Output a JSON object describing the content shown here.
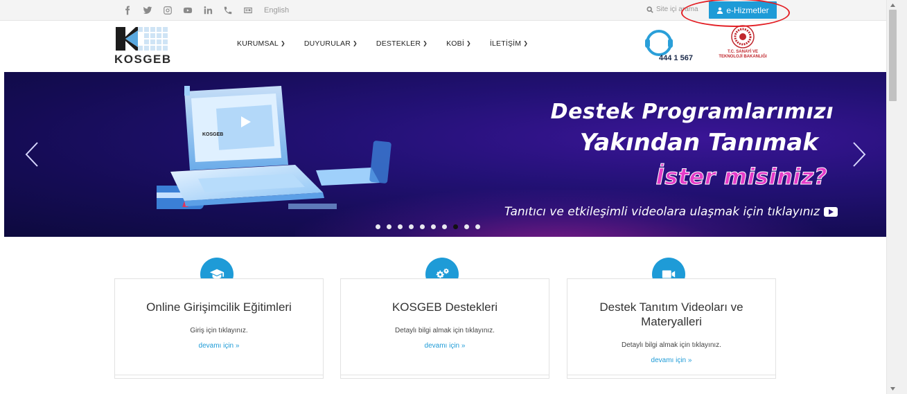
{
  "topbar": {
    "social_icons": [
      "facebook-icon",
      "twitter-icon",
      "instagram-icon",
      "youtube-icon",
      "linkedin-icon",
      "phone-icon",
      "contact-card-icon"
    ],
    "language_label": "English",
    "search_label": "Site içi arama",
    "eservices_label": "e-Hizmetler"
  },
  "header": {
    "logo_text": "KOSGEB",
    "nav": [
      {
        "label": "KURUMSAL"
      },
      {
        "label": "DUYURULAR"
      },
      {
        "label": "DESTEKLER"
      },
      {
        "label": "KOBİ"
      },
      {
        "label": "İLETİŞİM"
      }
    ],
    "call_center": "444 1 567",
    "ministry_line1": "T.C. SANAYİ VE",
    "ministry_line2": "TEKNOLOJİ BAKANLIĞI"
  },
  "hero": {
    "title_line1": "Destek Programlarımızı",
    "title_line2": "Yakından Tanımak",
    "title_line3": "İster misiniz?",
    "subtitle": "Tanıtıcı ve etkileşimli videolara ulaşmak için tıklayınız",
    "laptop_brand": "KOSGEB",
    "slide_count": 10,
    "active_slide": 8
  },
  "cards": [
    {
      "icon": "graduation-cap-icon",
      "title": "Online Girişimcilik Eğitimleri",
      "desc": "Giriş için tıklayınız.",
      "more": "devamı için »"
    },
    {
      "icon": "gears-icon",
      "title": "KOSGEB Destekleri",
      "desc": "Detaylı bilgi almak için tıklayınız.",
      "more": "devamı için »"
    },
    {
      "icon": "video-camera-icon",
      "title": "Destek Tanıtım Videoları ve Materyalleri",
      "desc": "Detaylı bilgi almak için tıklayınız.",
      "more": "devamı için »"
    }
  ],
  "colors": {
    "accent": "#1e9bd7",
    "annotation_ring": "#e31e24",
    "hero_bg": "#231176",
    "hero_highlight": "#e43bc9"
  }
}
